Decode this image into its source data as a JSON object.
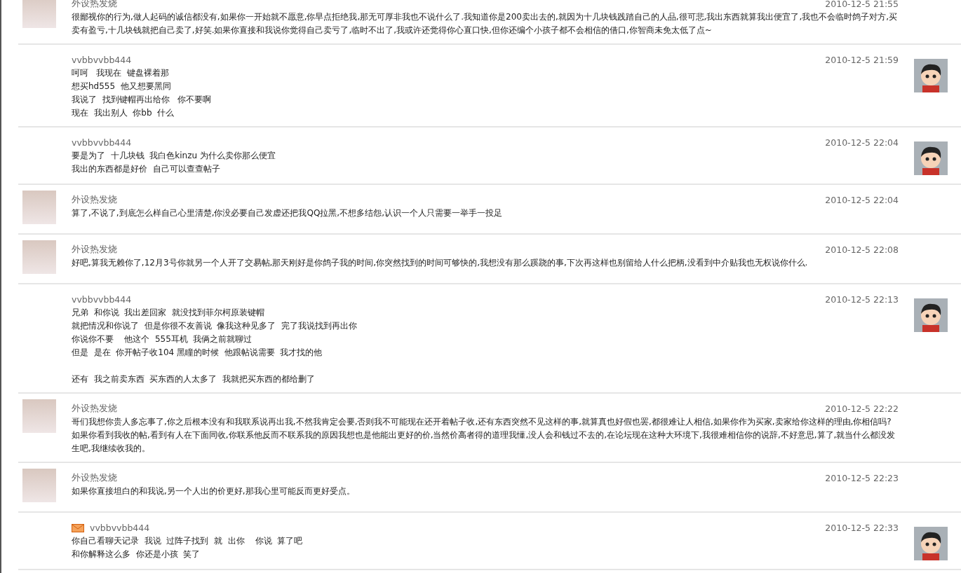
{
  "messages": [
    {
      "author": "外设热发烧",
      "time": "2010-12-5 21:55",
      "kind": "photo",
      "mail": false,
      "paragraphs": [
        [
          "很鄙视你的行为,做人起码的诚信都没有,如果你一开始就不愿意,你早点拒绝我,那无可厚非我也不说什么了.我知道你是200卖出去的,就因为十几块钱践踏自己的人品,很可悲,我出东西就算我出便宜了,我也不会临时鸽子对方,买卖有盈亏,十几块钱就把自己卖了,好笑.如果你直接和我说你觉得自己卖亏了,临时不出了,我或许还觉得你心直口快,但你还编个小孩子都不会相信的借口,你智商未免太低了点~"
        ]
      ]
    },
    {
      "author": "vvbbvvbb444",
      "time": "2010-12-5 21:59",
      "kind": "cartoon",
      "mail": false,
      "paragraphs": [
        [
          "呵呵   我现在  键盘裸着那",
          "想买hd555  他又想要黑同",
          "我说了  找到键帽再出给你   你不要啊",
          "现在  我出别人  你bb  什么"
        ]
      ]
    },
    {
      "author": "vvbbvvbb444",
      "time": "2010-12-5 22:04",
      "kind": "cartoon",
      "mail": false,
      "paragraphs": [
        [
          "要是为了  十几块钱  我白色kinzu 为什么卖你那么便宜",
          "我出的东西都是好价  自己可以查查帖子"
        ]
      ]
    },
    {
      "author": "外设热发烧",
      "time": "2010-12-5 22:04",
      "kind": "photo",
      "mail": false,
      "paragraphs": [
        [
          "算了,不说了,到底怎么样自己心里清楚,你没必要自己发虚还把我QQ拉黑,不想多结怨,认识一个人只需要一举手一投足"
        ]
      ]
    },
    {
      "author": "外设热发烧",
      "time": "2010-12-5 22:08",
      "kind": "photo",
      "mail": false,
      "paragraphs": [
        [
          "好吧,算我无赖你了,12月3号你就另一个人开了交易帖,那天刚好是你鸽子我的时间,你突然找到的时间可够快的,我想没有那么蹊跷的事,下次再这样也别留给人什么把柄,没看到中介贴我也无权说你什么."
        ]
      ]
    },
    {
      "author": "vvbbvvbb444",
      "time": "2010-12-5 22:13",
      "kind": "cartoon",
      "mail": false,
      "paragraphs": [
        [
          "兄弟  和你说  我出差回家  就没找到菲尔柯原装键帽",
          "就把情况和你说了  但是你很不友善说  像我这种见多了  完了我说找到再出你",
          "你说你不要    他这个  555耳机  我俩之前就聊过",
          "但是  是在  你开帖子收104 黑瞳的时候  他跟帖说需要  我才找的他"
        ],
        [
          "还有  我之前卖东西  买东西的人太多了  我就把买东西的都给删了"
        ]
      ]
    },
    {
      "author": "外设热发烧",
      "time": "2010-12-5 22:22",
      "kind": "photo",
      "mail": false,
      "paragraphs": [
        [
          "哥们我想你贵人多忘事了,你之后根本没有和我联系说再出我,不然我肯定会要,否则我不可能现在还开着帖子收,还有东西突然不见这样的事,就算真也好假也罢,都很难让人相信,如果你作为买家,卖家给你这样的理由,你相信吗?如果你看到我收的帖,看到有人在下面同收,你联系他反而不联系我的原因我想也是他能出更好的价,当然价高者得的道理我懂,没人会和钱过不去的,在论坛现在这种大环境下,我很难相信你的说辞,不好意思,算了,就当什么都没发生吧,我继续收我的。"
        ]
      ]
    },
    {
      "author": "外设热发烧",
      "time": "2010-12-5 22:23",
      "kind": "photo",
      "mail": false,
      "paragraphs": [
        [
          "如果你直接坦白的和我说,另一个人出的价更好,那我心里可能反而更好受点。"
        ]
      ]
    },
    {
      "author": "vvbbvvbb444",
      "time": "2010-12-5 22:33",
      "kind": "cartoon",
      "mail": true,
      "paragraphs": [
        [
          "你自己看聊天记录  我说  过阵子找到  就  出你    你说  算了吧",
          "和你解释这么多  你还是小孩  笑了"
        ]
      ]
    }
  ]
}
